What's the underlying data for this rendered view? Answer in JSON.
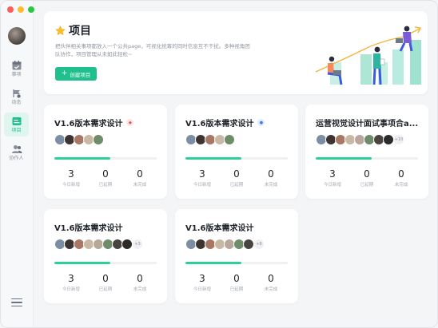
{
  "window": {
    "traffic_lights": [
      "close",
      "minimize",
      "zoom"
    ]
  },
  "sidebar": {
    "items": [
      {
        "label": "事项",
        "icon": "calendar-icon",
        "active": false
      },
      {
        "label": "动态",
        "icon": "activity-icon",
        "active": false
      },
      {
        "label": "项目",
        "icon": "project-icon",
        "active": true
      },
      {
        "label": "协作人",
        "icon": "collaborators-icon",
        "active": false
      }
    ],
    "menu_icon": "hamburger-menu-icon"
  },
  "hero": {
    "title": "项目",
    "icon": "star-icon",
    "description": "把伙伴相关事项都放入一个公共page，可视化统筹的同时信息互不干扰。多种视角团队协作，项目管理从未如此轻松~",
    "create_button": "创建项目"
  },
  "stat_labels": [
    "今日新增",
    "已延期",
    "未完成"
  ],
  "colors": {
    "accent": "#1fc08d",
    "progress": "#2ccf98"
  },
  "cards": [
    {
      "title": "V1.6版本需求设计",
      "badge": "red",
      "more_count": "",
      "progress": 0.55,
      "stats": [
        "3",
        "0",
        "0"
      ]
    },
    {
      "title": "V1.6版本需求设计",
      "badge": "blue",
      "more_count": "",
      "progress": 0.55,
      "stats": [
        "3",
        "0",
        "0"
      ]
    },
    {
      "title": "运营视觉设计面试事项合a...",
      "badge": "",
      "more_count": "+10",
      "progress": 0.55,
      "stats": [
        "3",
        "0",
        "0"
      ]
    },
    {
      "title": "V1.6版本需求设计",
      "badge": "",
      "more_count": "+3",
      "progress": 0.55,
      "stats": [
        "3",
        "0",
        "0"
      ]
    },
    {
      "title": "V1.6版本需求设计",
      "badge": "",
      "more_count": "+8",
      "progress": 0.55,
      "stats": [
        "3",
        "0",
        "0"
      ]
    }
  ]
}
